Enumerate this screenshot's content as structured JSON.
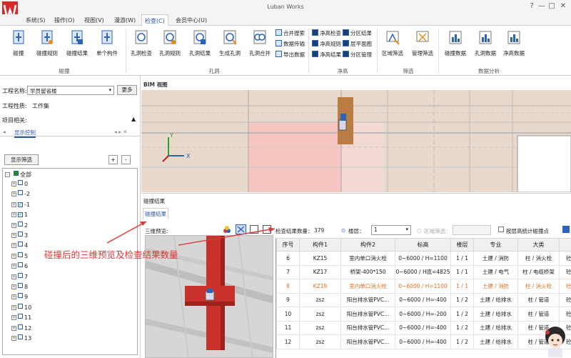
{
  "app": {
    "title": "Luban Works",
    "window_controls": [
      "?",
      "—",
      "□",
      "✕"
    ]
  },
  "menu": [
    "系统(S)",
    "操作(O)",
    "视图(V)",
    "漫游(W)",
    "检查(C)",
    "会员中心(U)"
  ],
  "menu_active_index": 4,
  "ribbon": {
    "collision": {
      "label": "碰撞",
      "buttons": [
        "碰撞",
        "碰撞规则",
        "碰撞结果",
        "单个构件"
      ]
    },
    "hole": {
      "label": "孔洞",
      "buttons": [
        "孔洞检查",
        "孔洞规则",
        "孔洞结果",
        "生成孔洞",
        "孔洞合并"
      ],
      "small": [
        "合并搜索",
        "数据传输",
        "导出数据"
      ]
    },
    "clearance": {
      "label": "净高",
      "small": [
        "净高检查",
        "分区结果",
        "净高规则",
        "层平面图",
        "净高结果",
        "分区管理"
      ]
    },
    "filter": {
      "label": "筛选",
      "buttons": [
        "区域筛选",
        "管理筛选"
      ]
    },
    "analysis": {
      "label": "数据分析",
      "buttons": [
        "碰撞数据",
        "孔洞数据",
        "净高数据"
      ]
    }
  },
  "left_panel": {
    "project_name_label": "工程名称:",
    "project_name_value": "学员留省楼",
    "more_button": "更多",
    "project_nature_label": "工程性质:",
    "project_nature_value": "工作集",
    "project_related_label": "项目相关:",
    "tab_label": "显示控制",
    "display_filter_button": "显示筛选",
    "tree_root": "全部",
    "tree_items": [
      {
        "label": "0",
        "state": "empty"
      },
      {
        "label": "-2",
        "state": "empty"
      },
      {
        "label": "-1",
        "state": "checked"
      },
      {
        "label": "1",
        "state": "checked"
      },
      {
        "label": "2",
        "state": "empty"
      },
      {
        "label": "3",
        "state": "empty"
      },
      {
        "label": "4",
        "state": "empty"
      },
      {
        "label": "5",
        "state": "empty"
      },
      {
        "label": "6",
        "state": "empty"
      },
      {
        "label": "7",
        "state": "empty"
      },
      {
        "label": "8",
        "state": "empty"
      },
      {
        "label": "9",
        "state": "empty"
      },
      {
        "label": "10",
        "state": "empty"
      },
      {
        "label": "11",
        "state": "empty"
      },
      {
        "label": "12",
        "state": "empty"
      },
      {
        "label": "13",
        "state": "empty"
      }
    ]
  },
  "bim": {
    "tab_label": "BIM 视图"
  },
  "results": {
    "pane_title": "碰撞结果",
    "tab_label": "碰撞结果",
    "preview_label": "三维预览:",
    "count_label": "检查结果数量：",
    "count_value": "379",
    "floor_label": "楼层：",
    "floor_value": "1",
    "area_filter_label": "区域筛选：",
    "floor_stat_label": "按层高统计碰撞点",
    "columns": [
      "序号",
      "构件1",
      "构件2",
      "标高",
      "楼层",
      "专业",
      "大类",
      ""
    ],
    "rows": [
      {
        "id": "6",
        "c1": "KZ15",
        "c2": "室内单口消火栓",
        "elev": "0~6000 / H=1100",
        "floor": "1 / 1",
        "major": "土建 / 消防",
        "cat": "柱 / 消火栓",
        "extra": "砼柱",
        "hl": false
      },
      {
        "id": "7",
        "c1": "KZ17",
        "c2": "桥架-400*150",
        "elev": "0~6000 / H底=4825",
        "floor": "1 / 1",
        "major": "土建 / 电气",
        "cat": "柱 / 电缆桥架",
        "extra": "砼柱",
        "hl": false
      },
      {
        "id": "8",
        "c1": "KZ19",
        "c2": "室内单口消火栓",
        "elev": "0~6000 / H=1100",
        "floor": "1 / 1",
        "major": "土建 / 消防",
        "cat": "柱 / 消火栓",
        "extra": "砼柱",
        "hl": true
      },
      {
        "id": "9",
        "c1": "zsz",
        "c2": "阳台排水管PVC...",
        "elev": "0~6000 / H=-400",
        "floor": "1 / 2",
        "major": "土建 / 给排水",
        "cat": "柱 / 管道",
        "extra": "砼柱",
        "hl": false
      },
      {
        "id": "10",
        "c1": "zsz",
        "c2": "阳台排水管PVC...",
        "elev": "0~6000 / H=-200",
        "floor": "1 / 2",
        "major": "土建 / 给排水",
        "cat": "柱 / 管道",
        "extra": "砼柱",
        "hl": false
      },
      {
        "id": "11",
        "c1": "zsz",
        "c2": "阳台排水管PVC...",
        "elev": "0~6000 / H=-400",
        "floor": "1 / 2",
        "major": "土建 / 给排水",
        "cat": "柱 / 管道",
        "extra": "砼柱",
        "hl": false
      },
      {
        "id": "12",
        "c1": "zsz",
        "c2": "阳台排水管PVC...",
        "elev": "0~6000 / H=-400",
        "floor": "1 / 2",
        "major": "土建 / 给排水",
        "cat": "柱 / 管道",
        "extra": "砼柱",
        "hl": false
      }
    ]
  },
  "annotation": "碰撞后的三维预览及检查结果数量",
  "colors": {
    "accent_blue": "#2a5aa8",
    "highlight_orange": "#e07020",
    "annotation_red": "#e03838",
    "column_red": "#c9322a"
  }
}
